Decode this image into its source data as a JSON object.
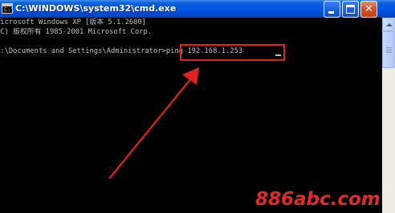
{
  "window": {
    "title": "C:\\WINDOWS\\system32\\cmd.exe",
    "icon": "console-app-icon",
    "icon_glyph": "C:\\",
    "controls": {
      "minimize_icon": "minimize-icon",
      "maximize_icon": "maximize-icon",
      "close_symbol": "✕"
    }
  },
  "console": {
    "lines": [
      "Microsoft Windows XP [版本 5.1.2600]",
      "(C) 版权所有 1985-2001 Microsoft Corp.",
      "",
      "C:\\Documents and Settings\\Administrator>ping 192.168.1.253"
    ],
    "text_color": "#c0c0c0",
    "background": "#000000"
  },
  "annotation": {
    "highlight_color": "#e0221e",
    "arrow_color": "#e0221e"
  },
  "watermark": {
    "text": "886abc.com",
    "color": "#e02b2b"
  }
}
